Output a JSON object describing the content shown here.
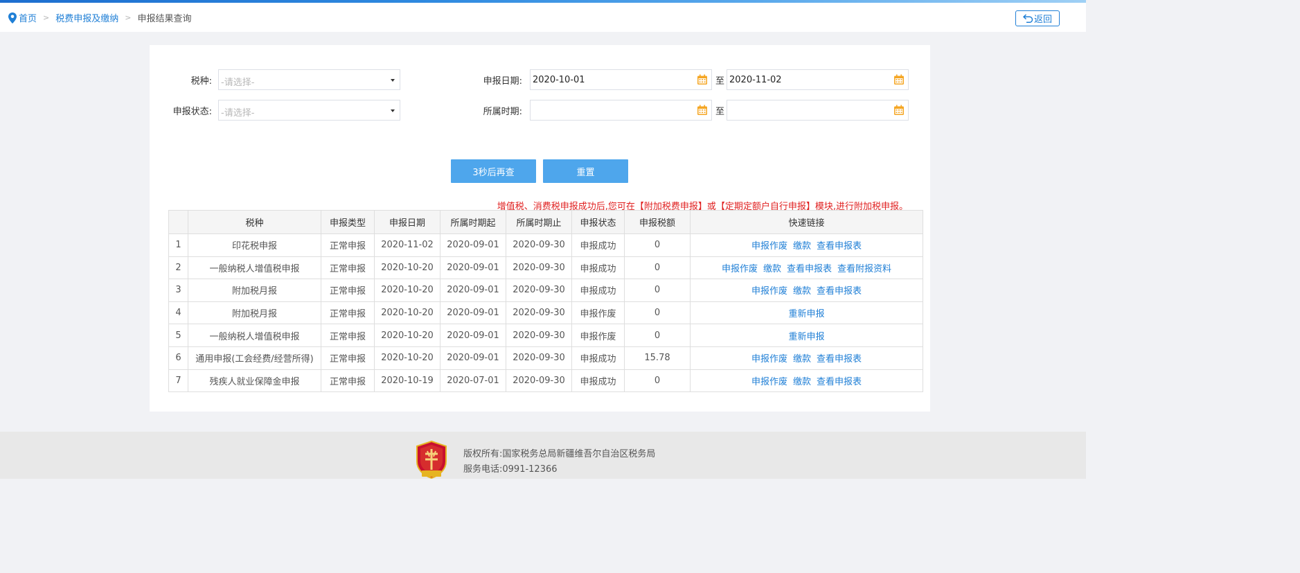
{
  "breadcrumb": {
    "home": "首页",
    "level2": "税费申报及缴纳",
    "current": "申报结果查询",
    "sep": ">"
  },
  "back_label": "返回",
  "form": {
    "tax_type_label": "税种:",
    "tax_type_placeholder": "-请选择-",
    "status_label": "申报状态:",
    "status_placeholder": "-请选择-",
    "decl_date_label": "申报日期:",
    "decl_date_from": "2020-10-01",
    "decl_date_to": "2020-11-02",
    "period_label": "所属时期:",
    "period_from": "",
    "period_to": "",
    "to_label": "至"
  },
  "buttons": {
    "query": "3秒后再查",
    "reset": "重置"
  },
  "notice": "增值税、消费税申报成功后,您可在【附加税费申报】或【定期定额户自行申报】模块,进行附加税申报。",
  "table": {
    "columns": [
      "",
      "税种",
      "申报类型",
      "申报日期",
      "所属时期起",
      "所属时期止",
      "申报状态",
      "申报税额",
      "快速链接"
    ],
    "rows": [
      {
        "no": "1",
        "tax": "印花税申报",
        "type": "正常申报",
        "date": "2020-11-02",
        "from": "2020-09-01",
        "to": "2020-09-30",
        "status": "申报成功",
        "amount": "0",
        "links": [
          "申报作废",
          "缴款",
          "查看申报表"
        ]
      },
      {
        "no": "2",
        "tax": "一般纳税人增值税申报",
        "type": "正常申报",
        "date": "2020-10-20",
        "from": "2020-09-01",
        "to": "2020-09-30",
        "status": "申报成功",
        "amount": "0",
        "links": [
          "申报作废",
          "缴款",
          "查看申报表",
          "查看附报资料"
        ]
      },
      {
        "no": "3",
        "tax": "附加税月报",
        "type": "正常申报",
        "date": "2020-10-20",
        "from": "2020-09-01",
        "to": "2020-09-30",
        "status": "申报成功",
        "amount": "0",
        "links": [
          "申报作废",
          "缴款",
          "查看申报表"
        ]
      },
      {
        "no": "4",
        "tax": "附加税月报",
        "type": "正常申报",
        "date": "2020-10-20",
        "from": "2020-09-01",
        "to": "2020-09-30",
        "status": "申报作废",
        "amount": "0",
        "links": [
          "重新申报"
        ]
      },
      {
        "no": "5",
        "tax": "一般纳税人增值税申报",
        "type": "正常申报",
        "date": "2020-10-20",
        "from": "2020-09-01",
        "to": "2020-09-30",
        "status": "申报作废",
        "amount": "0",
        "links": [
          "重新申报"
        ]
      },
      {
        "no": "6",
        "tax": "通用申报(工会经费/经营所得)",
        "type": "正常申报",
        "date": "2020-10-20",
        "from": "2020-09-01",
        "to": "2020-09-30",
        "status": "申报成功",
        "amount": "15.78",
        "links": [
          "申报作废",
          "缴款",
          "查看申报表"
        ]
      },
      {
        "no": "7",
        "tax": "残疾人就业保障金申报",
        "type": "正常申报",
        "date": "2020-10-19",
        "from": "2020-07-01",
        "to": "2020-09-30",
        "status": "申报成功",
        "amount": "0",
        "links": [
          "申报作废",
          "缴款",
          "查看申报表"
        ]
      }
    ]
  },
  "footer": {
    "copyright": "版权所有:国家税务总局新疆维吾尔自治区税务局",
    "phone": "服务电话:0991-12366",
    "emblem_text": "税务机关"
  },
  "colors": {
    "link": "#1f7fd6",
    "button": "#4ea6ec",
    "notice": "#e02020",
    "calendar_icon": "#f5a623"
  },
  "icons": {
    "location": "location-pin-icon",
    "back": "return-arrow-icon",
    "dropdown": "caret-down-icon",
    "calendar": "calendar-icon",
    "emblem": "tax-emblem-icon"
  }
}
